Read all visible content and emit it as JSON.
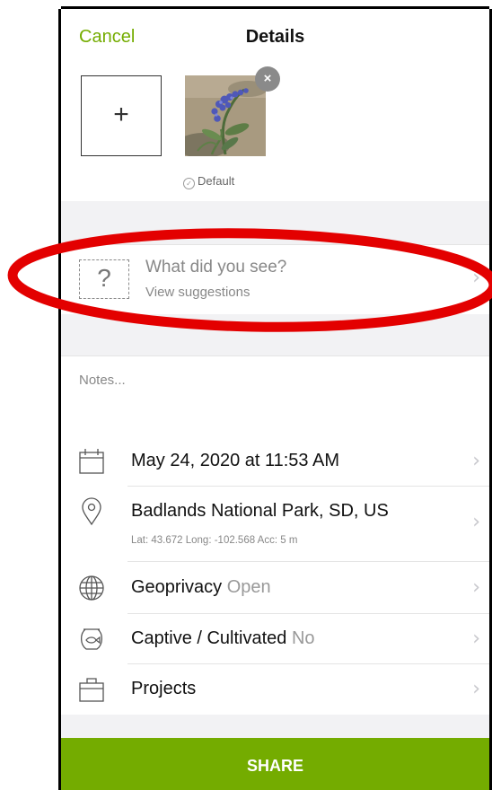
{
  "navbar": {
    "cancel_label": "Cancel",
    "title": "Details"
  },
  "photos": {
    "add_label": "+",
    "remove_label": "×",
    "default_label": "Default",
    "default_check": "✓"
  },
  "species": {
    "icon_label": "?",
    "title": "What did you see?",
    "subtitle": "View suggestions"
  },
  "notes": {
    "placeholder": "Notes..."
  },
  "rows": {
    "date": {
      "label": "May 24, 2020 at 11:53 AM"
    },
    "location": {
      "label": "Badlands National Park, SD, US",
      "coords": "Lat: 43.672  Long: -102.568  Acc: 5 m"
    },
    "geoprivacy": {
      "label": "Geoprivacy",
      "value": "Open"
    },
    "captive": {
      "label": "Captive / Cultivated",
      "value": "No"
    },
    "projects": {
      "label": "Projects"
    }
  },
  "chevron": "›",
  "share": {
    "label": "SHARE"
  },
  "colors": {
    "accent": "#74ac00",
    "annotation": "#e30000"
  }
}
